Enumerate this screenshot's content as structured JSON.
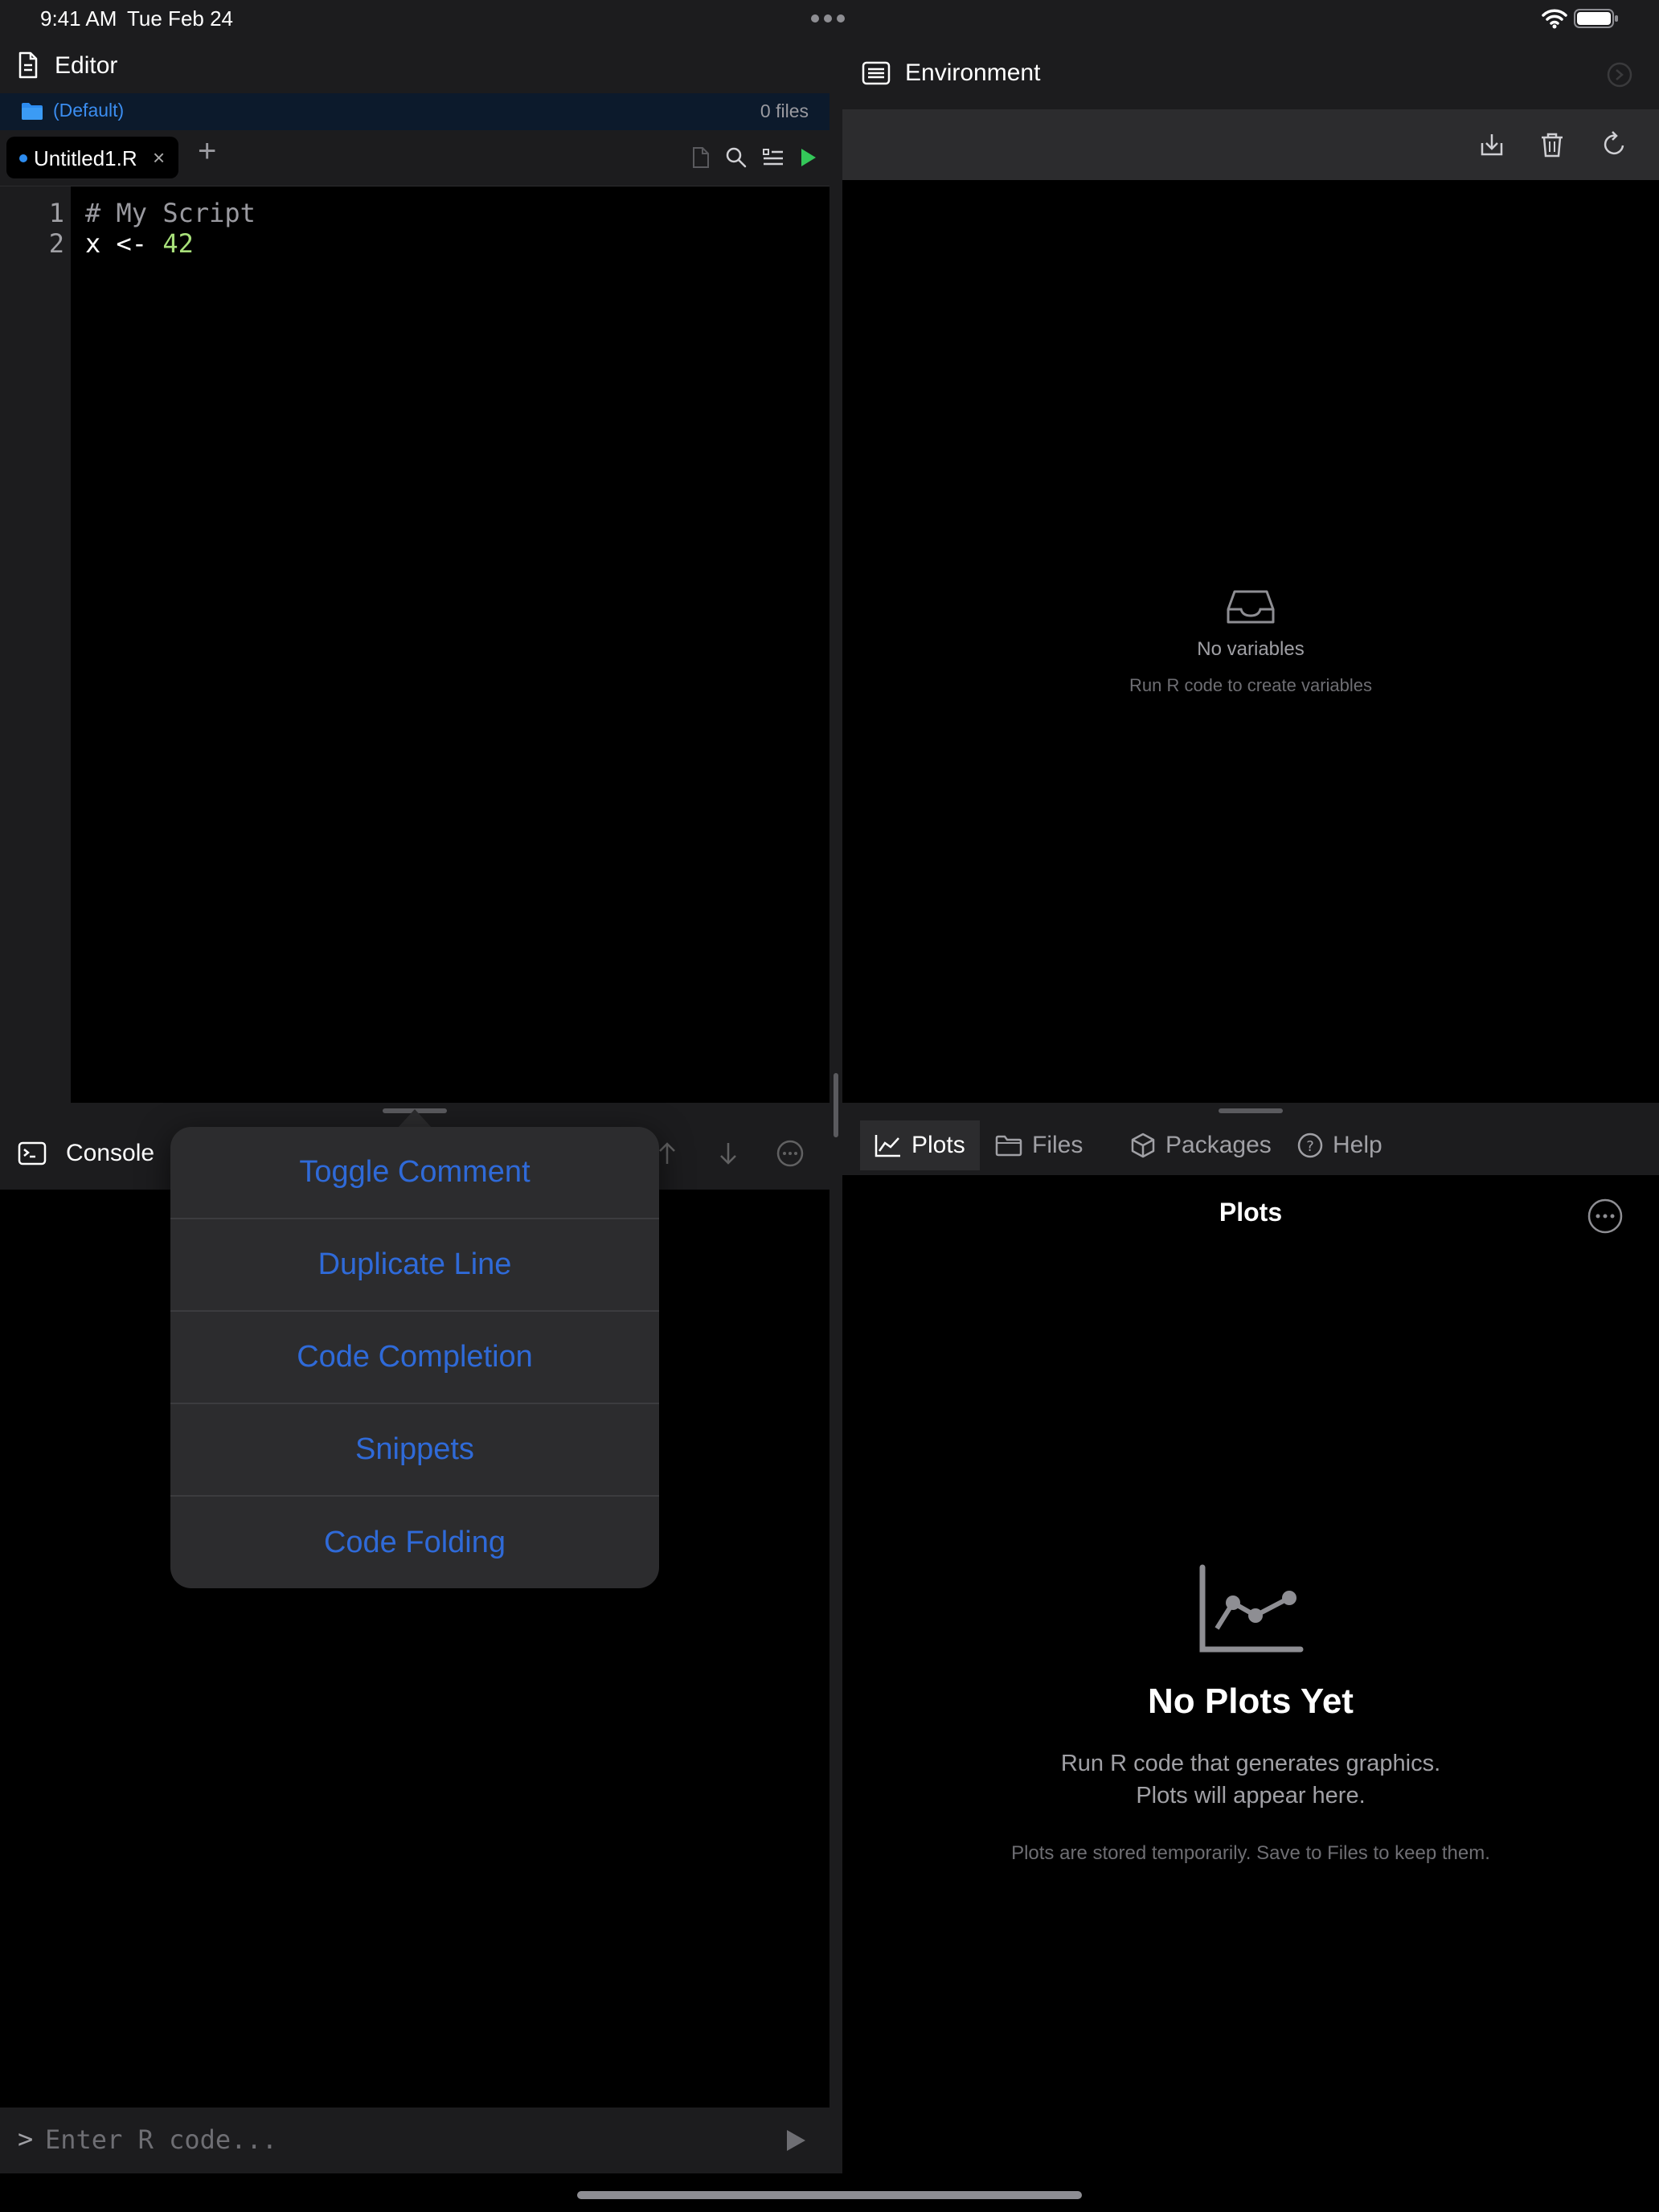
{
  "status_bar": {
    "time": "9:41 AM",
    "date": "Tue Feb 24"
  },
  "editor": {
    "title": "Editor",
    "project": {
      "name": "(Default)",
      "file_count": "0 files"
    },
    "tabs": [
      {
        "label": "Untitled1.R",
        "close": "×"
      }
    ],
    "add_tab": "+",
    "lines": [
      {
        "number": "1",
        "text": "# My Script"
      },
      {
        "number": "2",
        "code_var": "x",
        "code_op": " <- ",
        "code_num": "42"
      }
    ]
  },
  "console": {
    "title": "Console",
    "prompt": ">",
    "input_placeholder": "Enter R code..."
  },
  "environment": {
    "title": "Environment",
    "empty_title": "No variables",
    "empty_subtitle": "Run R code to create variables"
  },
  "pane_tabs": {
    "items": [
      {
        "label": "Plots"
      },
      {
        "label": "Files"
      },
      {
        "label": "Packages"
      },
      {
        "label": "Help"
      }
    ]
  },
  "plots": {
    "title": "Plots",
    "empty_title": "No Plots Yet",
    "empty_line1": "Run R code that generates graphics.",
    "empty_line2": "Plots will appear here.",
    "note": "Plots are stored temporarily. Save to Files to keep them."
  },
  "menu": {
    "items": [
      {
        "label": "Toggle Comment"
      },
      {
        "label": "Duplicate Line"
      },
      {
        "label": "Code Completion"
      },
      {
        "label": "Snippets"
      },
      {
        "label": "Code Folding"
      }
    ]
  },
  "colors": {
    "accent": "#2d8cf0",
    "menu_text": "#2f6ad8",
    "run_green": "#34c759",
    "comment": "#9a9aa0",
    "number": "#a8e07a"
  }
}
